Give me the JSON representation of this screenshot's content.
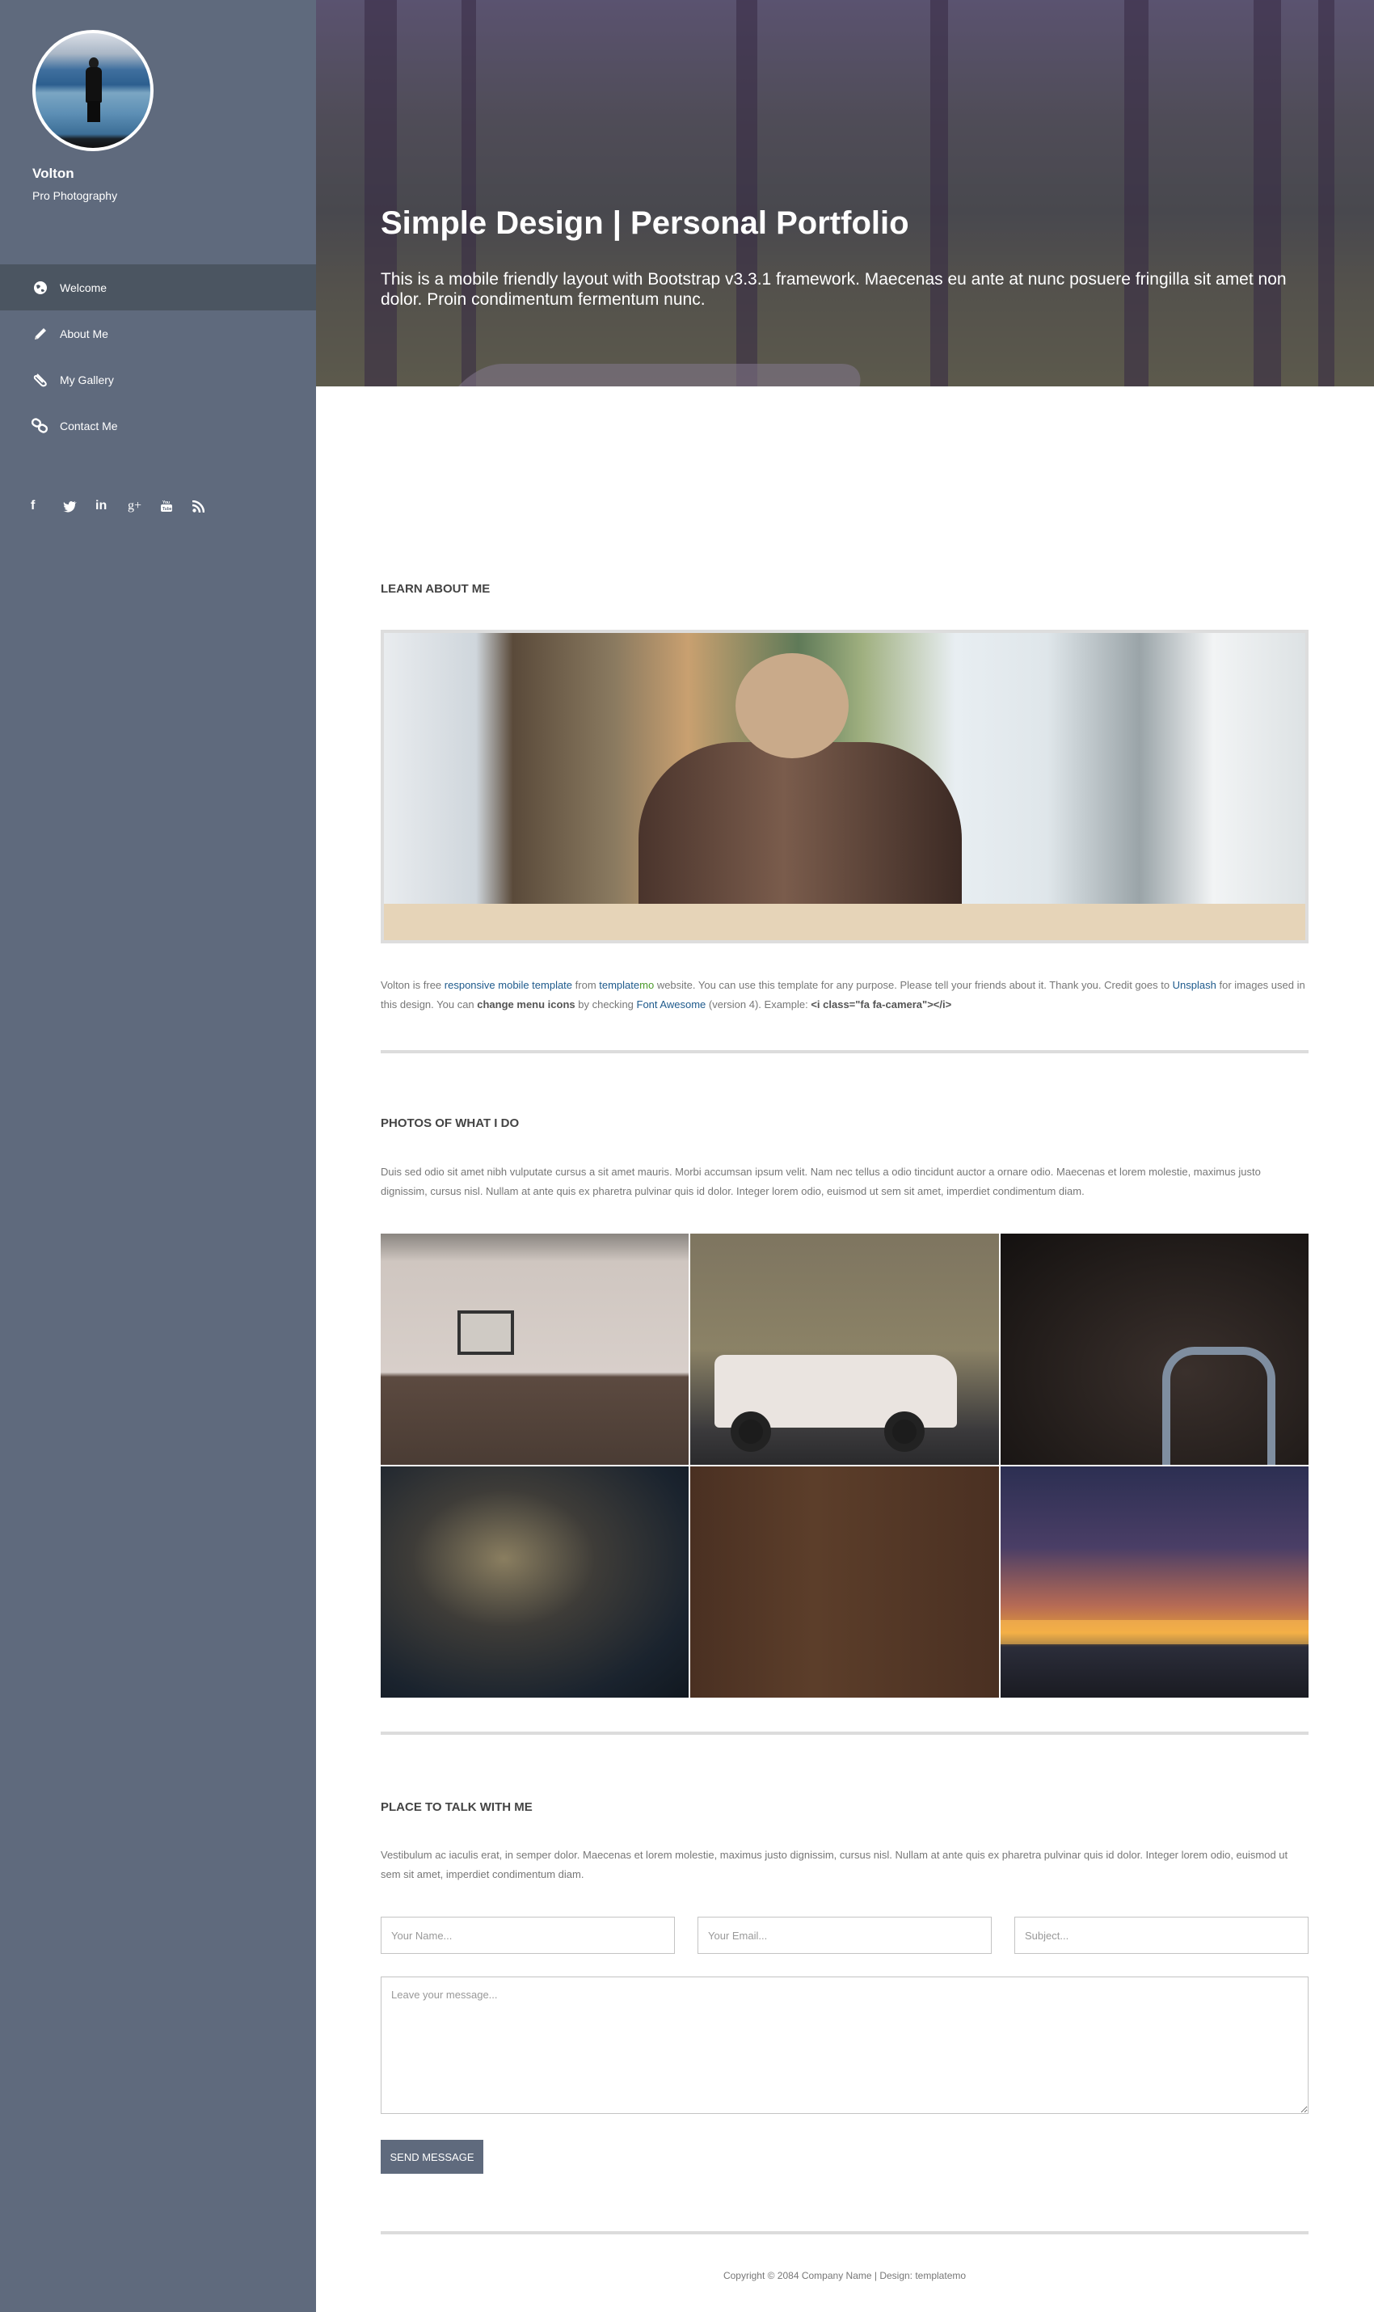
{
  "sidebar": {
    "profile": {
      "name": "Volton",
      "subtitle": "Pro Photography"
    },
    "nav": [
      {
        "label": "Welcome",
        "icon": "globe-icon",
        "active": true
      },
      {
        "label": "About Me",
        "icon": "pencil-icon",
        "active": false
      },
      {
        "label": "My Gallery",
        "icon": "paperclip-icon",
        "active": false
      },
      {
        "label": "Contact Me",
        "icon": "link-icon",
        "active": false
      }
    ],
    "social": [
      {
        "name": "facebook",
        "glyph": "f"
      },
      {
        "name": "twitter",
        "glyph": "🐦"
      },
      {
        "name": "linkedin",
        "glyph": "in"
      },
      {
        "name": "google-plus",
        "glyph": "g+"
      },
      {
        "name": "youtube",
        "glyph": "▣"
      },
      {
        "name": "rss",
        "glyph": "◝"
      }
    ],
    "colors": {
      "background": "#5f6a7d",
      "active": "#4b5561"
    }
  },
  "hero": {
    "title": "Simple Design | Personal Portfolio",
    "text": "This is a mobile friendly layout with Bootstrap v3.3.1 framework. Maecenas eu ante at nunc posuere fringilla sit amet non dolor. Proin condimentum fermentum nunc."
  },
  "about": {
    "heading": "LEARN ABOUT ME",
    "p_parts": {
      "t1": "Volton is free ",
      "l1": "responsive mobile template",
      "t2": " from ",
      "l2a": "template",
      "l2b": "mo",
      "t3": " website. You can use this template for any purpose. Please tell your friends about it. Thank you. Credit goes to ",
      "l3": "Unsplash",
      "t4": " for images used in this design. You can ",
      "b1": "change menu icons",
      "t5": " by checking ",
      "l4": "Font Awesome",
      "t6": " (version 4). Example: ",
      "b2": "<i class=\"fa fa-camera\"></i>"
    }
  },
  "photos": {
    "heading": "PHOTOS OF WHAT I DO",
    "text": "Duis sed odio sit amet nibh vulputate cursus a sit amet mauris. Morbi accumsan ipsum velit. Nam nec tellus a odio tincidunt auctor a ornare odio. Maecenas et lorem molestie, maximus justo dignissim, cursus nisl. Nullam at ante quis ex pharetra pulvinar quis id dolor. Integer lorem odio, euismod ut sem sit amet, imperdiet condimentum diam.",
    "gallery": [
      "cafe interior",
      "white off-road car",
      "old machinery",
      "woman with dog",
      "vintage tools",
      "pier at sunset"
    ]
  },
  "contact": {
    "heading": "PLACE TO TALK WITH ME",
    "text": "Vestibulum ac iaculis erat, in semper dolor. Maecenas et lorem molestie, maximus justo dignissim, cursus nisl. Nullam at ante quis ex pharetra pulvinar quis id dolor. Integer lorem odio, euismod ut sem sit amet, imperdiet condimentum diam.",
    "form": {
      "name_placeholder": "Your Name...",
      "email_placeholder": "Your Email...",
      "subject_placeholder": "Subject...",
      "message_placeholder": "Leave your message...",
      "submit_label": "SEND MESSAGE"
    }
  },
  "footer": {
    "text": "Copyright © 2084 Company Name | Design: templatemo"
  }
}
